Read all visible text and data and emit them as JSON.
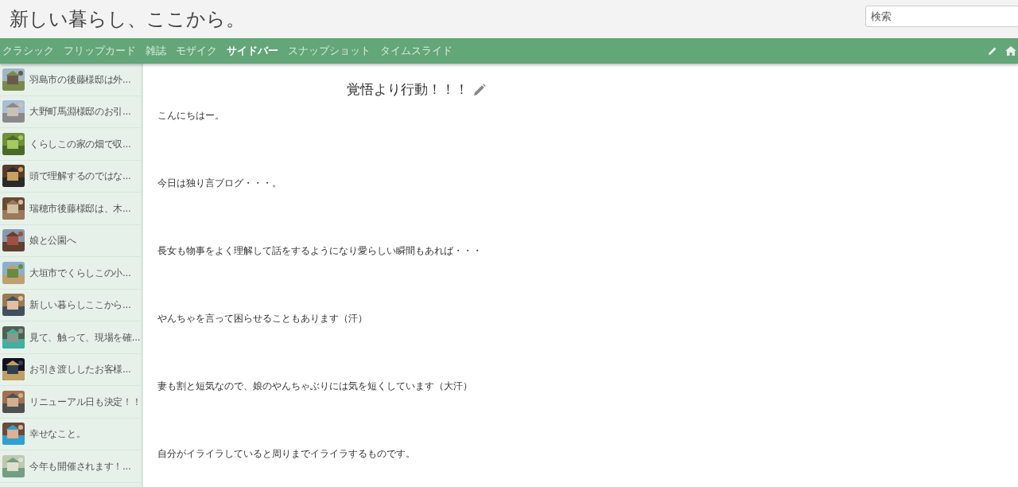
{
  "header": {
    "site_title": "新しい暮らし、ここから。",
    "search": {
      "placeholder": "検索"
    }
  },
  "nav": {
    "tabs": [
      {
        "label": "クラシック",
        "selected": false
      },
      {
        "label": "フリップカード",
        "selected": false
      },
      {
        "label": "雑誌",
        "selected": false
      },
      {
        "label": "モザイク",
        "selected": false
      },
      {
        "label": "サイドバー",
        "selected": true
      },
      {
        "label": "スナップショット",
        "selected": false
      },
      {
        "label": "タイムスライド",
        "selected": false
      }
    ]
  },
  "sidebar": {
    "items": [
      {
        "title": "羽島市の後藤様邸は外..."
      },
      {
        "title": "大野町馬淵様邸のお引..."
      },
      {
        "title": "くらしこの家の畑で収..."
      },
      {
        "title": "頭で理解するのではな..."
      },
      {
        "title": "瑞穂市後藤様邸は、木..."
      },
      {
        "title": "娘と公園へ"
      },
      {
        "title": "大垣市でくらしこの小..."
      },
      {
        "title": "新しい暮らしここから..."
      },
      {
        "title": "見て、触って、現場を確..."
      },
      {
        "title": "お引き渡ししたお客様..."
      },
      {
        "title": "リニューアル日も決定！！"
      },
      {
        "title": "幸せなこと。"
      },
      {
        "title": "今年も開催されます！..."
      }
    ]
  },
  "post": {
    "title": "覚悟より行動！！！",
    "paragraphs": [
      "こんにちはー。",
      "今日は独り言ブログ・・・。",
      "長女も物事をよく理解して話をするようになり愛らしい瞬間もあれば・・・",
      "やんちゃを言って困らせることもあります（汗）",
      "妻も割と短気なので、娘のやんちゃぶりには気を短くしています（大汗）",
      "自分がイライラしていると周りまでイライラするものです。"
    ]
  }
}
